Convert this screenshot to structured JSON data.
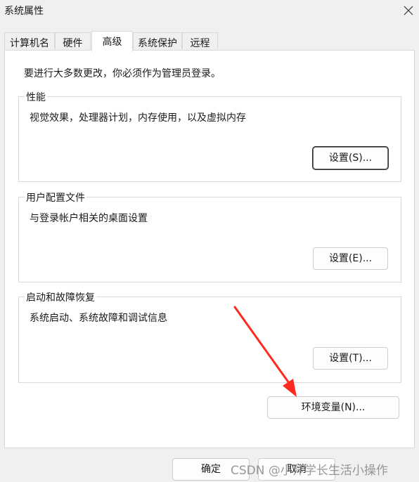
{
  "window": {
    "title": "系统属性"
  },
  "tabs": [
    {
      "label": "计算机名"
    },
    {
      "label": "硬件"
    },
    {
      "label": "高级"
    },
    {
      "label": "系统保护"
    },
    {
      "label": "远程"
    }
  ],
  "notice": "要进行大多数更改，你必须作为管理员登录。",
  "groups": {
    "performance": {
      "title": "性能",
      "description": "视觉效果，处理器计划，内存使用，以及虚拟内存",
      "button": "设置(S)..."
    },
    "user_profiles": {
      "title": "用户配置文件",
      "description": "与登录帐户相关的桌面设置",
      "button": "设置(E)..."
    },
    "startup_recovery": {
      "title": "启动和故障恢复",
      "description": "系统启动、系统故障和调试信息",
      "button": "设置(T)..."
    }
  },
  "env_button": "环境变量(N)...",
  "footer": {
    "ok": "确定",
    "cancel": "取消"
  },
  "watermark": "CSDN @小斧学长生活小操作",
  "colors": {
    "annotation_arrow": "#ff2a1f",
    "focus_border": "#2d2d2d"
  }
}
